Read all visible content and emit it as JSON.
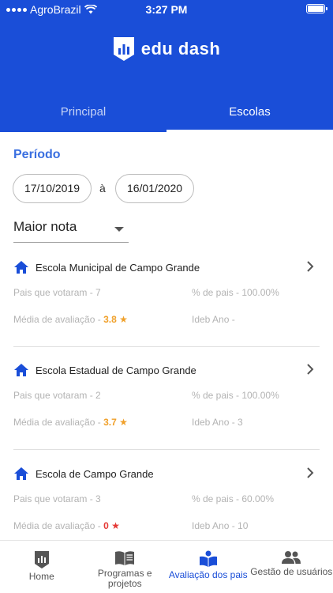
{
  "status": {
    "carrier": "AgroBrazil",
    "time": "3:27 PM"
  },
  "app": {
    "name": "edu dash"
  },
  "tabs": [
    {
      "label": "Principal",
      "active": false
    },
    {
      "label": "Escolas",
      "active": true
    }
  ],
  "filter": {
    "periodo_label": "Período",
    "date_start": "17/10/2019",
    "date_separator": "à",
    "date_end": "16/01/2020",
    "sort": "Maior nota"
  },
  "schools": [
    {
      "name": "Escola Municipal de Campo Grande",
      "pais_votaram": "Pais que votaram - 7",
      "pct_pais": "% de pais - 100.00%",
      "media_label": "Média de avaliação - ",
      "media_value": "3.8",
      "ideb": "Ideb Ano -"
    },
    {
      "name": "Escola Estadual de Campo Grande",
      "pais_votaram": "Pais que votaram - 2",
      "pct_pais": "% de pais - 100.00%",
      "media_label": "Média de avaliação - ",
      "media_value": "3.7",
      "ideb": "Ideb Ano - 3"
    },
    {
      "name": "Escola de Campo Grande",
      "pais_votaram": "Pais que votaram - 3",
      "pct_pais": "% de pais - 60.00%",
      "media_label": "Média de avaliação - ",
      "media_value": "0",
      "ideb": "Ideb Ano - 10"
    }
  ],
  "nav": [
    {
      "label": "Home",
      "icon": "home-chart-icon",
      "active": false
    },
    {
      "label": "Programas e projetos",
      "icon": "book-icon",
      "active": false
    },
    {
      "label": "Avaliação dos pais",
      "icon": "reader-icon",
      "active": true
    },
    {
      "label": "Gestão de usuários",
      "icon": "users-icon",
      "active": false
    }
  ],
  "colors": {
    "primary": "#1a4ed8",
    "accent_text": "#3a6fe0",
    "rating": "#f0a02a",
    "rating_zero": "#e53935"
  }
}
